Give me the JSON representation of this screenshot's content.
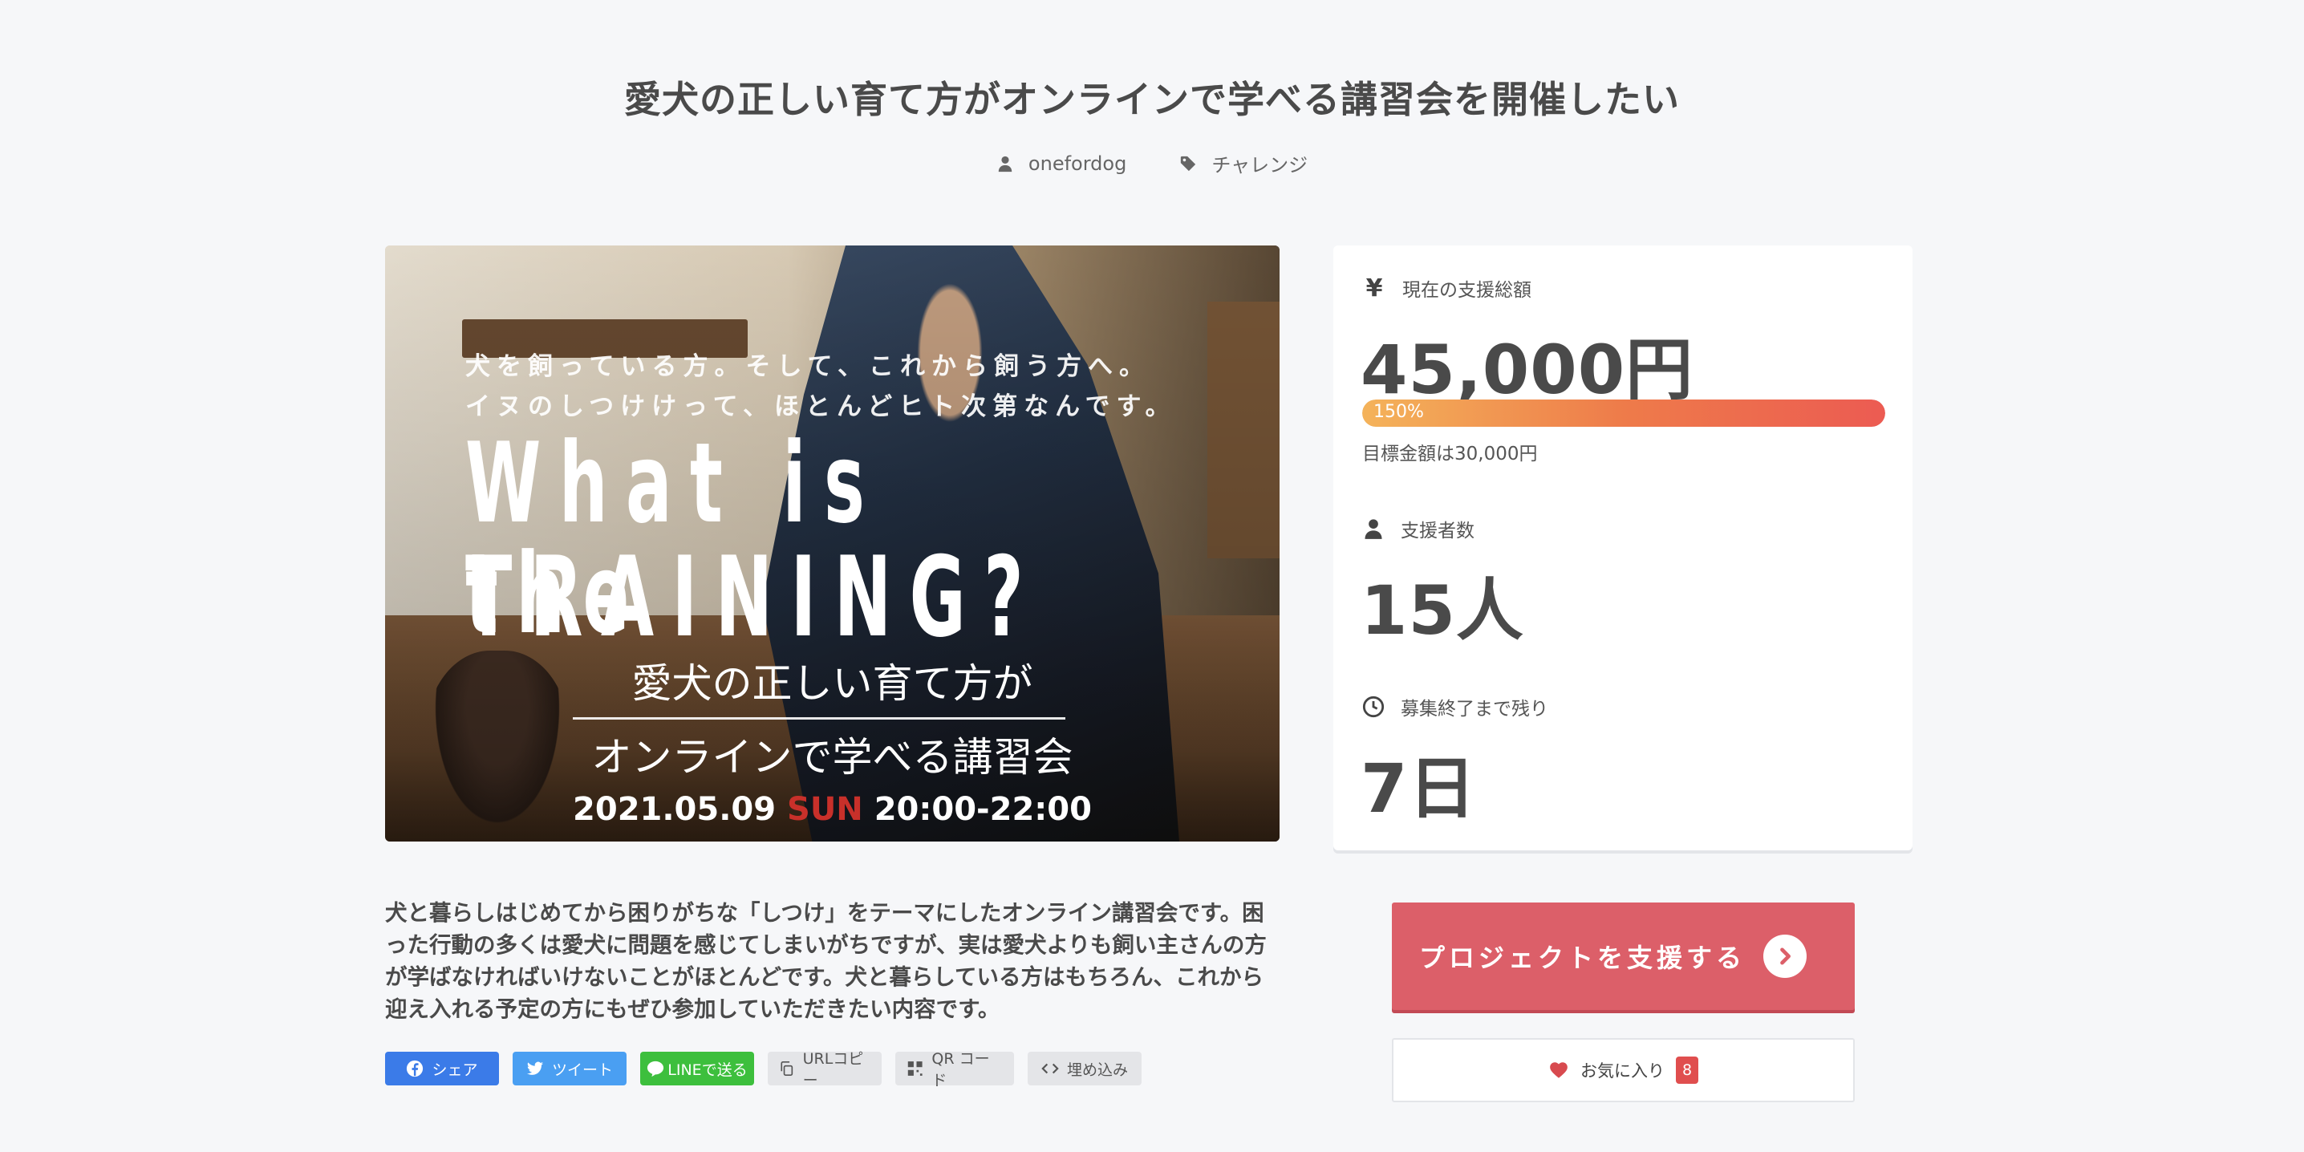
{
  "project": {
    "title": "愛犬の正しい育て方がオンラインで学べる講習会を開催したい",
    "owner": "onefordog",
    "category": "チャレンジ"
  },
  "hero": {
    "line1": "犬を飼っている方。そして、これから飼う方へ。\nイヌのしつけけって、ほとんどヒト次第なんです。",
    "big1": "What is the",
    "big2": "TRAINING?",
    "jp1": "愛犬の正しい育て方が",
    "jp2": "オンラインで学べる講習会",
    "date_pre": "2021.05.09",
    "date_day": "SUN",
    "date_time": "20:00-22:00"
  },
  "stats": {
    "total_label": "現在の支援総額",
    "total_value": "45,000円",
    "progress_label": "150%",
    "progress_fraction": 1.0,
    "goal_text": "目標金額は30,000円",
    "backers_label": "支援者数",
    "backers_value": "15人",
    "remaining_label": "募集終了まで残り",
    "remaining_value": "7日"
  },
  "description": "犬と暮らしはじめてから困りがちな「しつけ」をテーマにしたオンライン講習会です。困った行動の多くは愛犬に問題を感じてしまいがちですが、実は愛犬よりも飼い主さんの方が学ばなければいけないことがほとんどです。犬と暮らしている方はもちろん、これから迎え入れる予定の方にもぜひ参加していただきたい内容です。",
  "share": {
    "facebook": "シェア",
    "twitter": "ツイート",
    "line": "LINEで送る",
    "url": "URLコピー",
    "qr": "QR コード",
    "embed": "埋め込み"
  },
  "cta": {
    "support_label": "プロジェクトを支援する",
    "favorite_label": "お気に入り",
    "favorite_count": "8"
  },
  "colors": {
    "accent": "#dc5f69",
    "facebook": "#3b7be8",
    "twitter": "#4a9ff2",
    "line": "#3dbf3d"
  }
}
